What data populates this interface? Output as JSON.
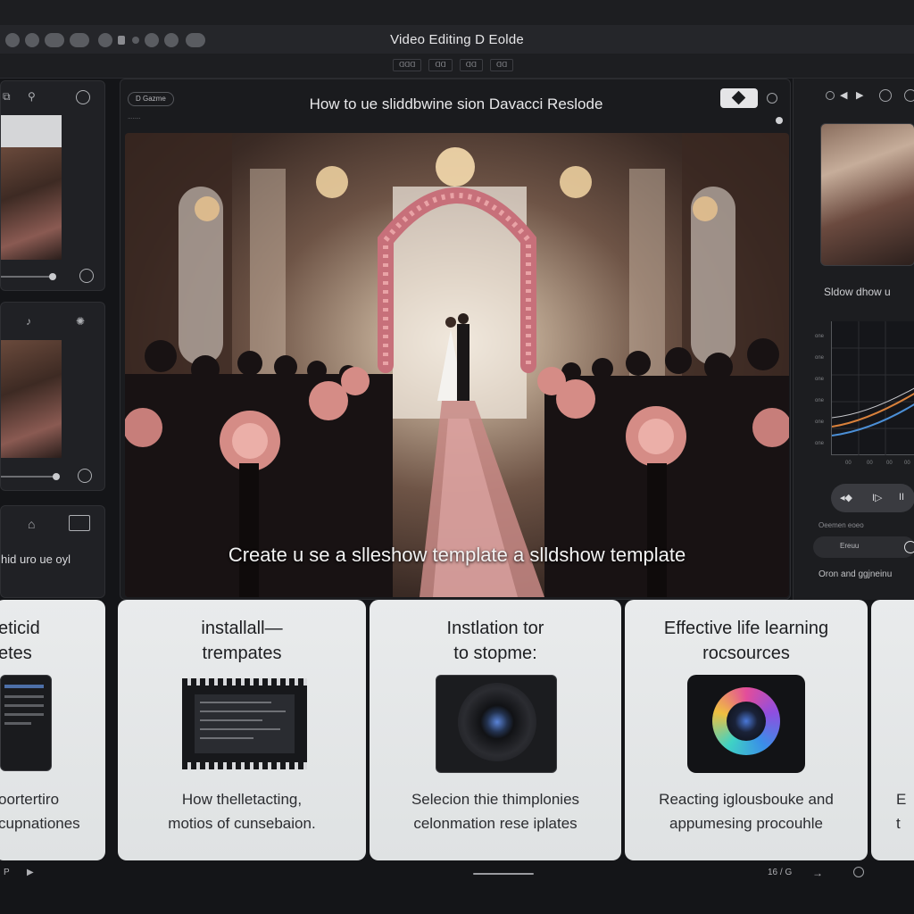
{
  "window": {
    "title": "Video Editing D Eolde",
    "tabs": [
      "ᗡᗡᗡ",
      "ᗡᗡ",
      "ᗡᗡ",
      "ᗡᗡ"
    ]
  },
  "left_panel": {
    "text_lines": [
      "hid uro ue oyl"
    ]
  },
  "main": {
    "tag_button": "D Gazme",
    "sub_label": "ᐧᐧᐧᐧᐧᐧᐧᐧ",
    "video_title": "How to ue sliddbwine sion Davacci Reslode",
    "caption": "Create u se a slleshow template a slldshow template"
  },
  "right_panel": {
    "label": "Sldow dhow u",
    "graph_y_ticks": [
      "one",
      "one",
      "one",
      "one",
      "one",
      "one"
    ],
    "graph_x_ticks": [
      "00",
      "00",
      "00",
      "00"
    ],
    "transport_icons": [
      "rewind-icon",
      "play-icon",
      "pause-icon"
    ],
    "small_label": "Oeemen eoeo",
    "pill_label": "Ereuu",
    "footer_label": "Oron and ggjneinu"
  },
  "cards": [
    {
      "title": "eticid\netes",
      "desc": "oortertiro\ncupnationes"
    },
    {
      "title": "installall—\ntrempates",
      "desc": "How thelletacting,\nmotios of cunsebaion."
    },
    {
      "title": "Instlation tor\nto stopme:",
      "desc": "Selecion thie thimplonies\ncelonmation rese iplates"
    },
    {
      "title": "Effective life learning\nrocsources",
      "desc": "Reacting iglousbouke and\nappumesing procouhle"
    },
    {
      "title": "",
      "desc": "E\nt"
    }
  ],
  "bottom_bar": {
    "left_text": "P",
    "page_indicator": "16 / G",
    "arrow": "→"
  },
  "colors": {
    "app_background": "#141518",
    "panel_background": "#1a1b1e",
    "card_background": "#e5e7e8",
    "accent_orange": "#d9813b",
    "accent_blue": "#4b8fd6"
  }
}
